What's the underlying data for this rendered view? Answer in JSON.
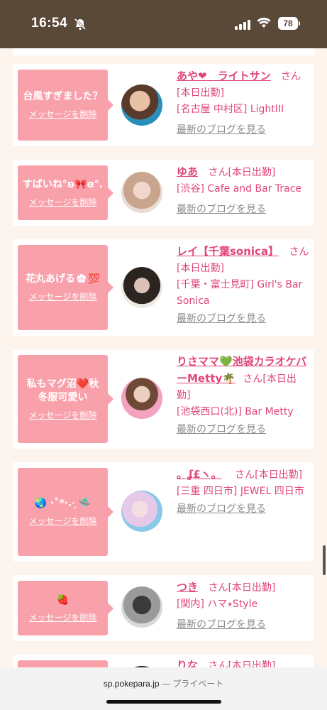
{
  "status": {
    "time": "16:54",
    "battery": "78"
  },
  "cards": [
    {
      "message": "台風すぎました？",
      "delete": "メッセージを削除",
      "name": "あや❤︎　ライトサン",
      "san": "さん",
      "line1": "[本日出勤]",
      "line2": "[名古屋 中村区] LightIII",
      "line3": "",
      "blog": "最新のブログを見る"
    },
    {
      "message": "すばいね°ʚ🎀ɞ°.",
      "delete": "メッセージを削除",
      "name": "ゆあ",
      "san": "さん[本日出勤]",
      "line1": "[渋谷] Cafe and Bar Trace",
      "line2": "",
      "line3": "",
      "blog": "最新のブログを見る"
    },
    {
      "message": "花丸あげる💮💯",
      "delete": "メッセージを削除",
      "name": "レイ【千葉sonica】",
      "san": "さん",
      "line1": "[本日出勤]",
      "line2": "[千葉・富士見町] Girl's Bar",
      "line3": "Sonica",
      "blog": "最新のブログを見る"
    },
    {
      "message": "私もマグ沼❤️秋冬服可愛い",
      "delete": "メッセージを削除",
      "name": "りさママ💚池袋カラオケバーMetty🌴",
      "san": "さん[本日出勤]",
      "line1": "[池袋西口(北)] Bar Metty",
      "line2": "",
      "line3": "",
      "blog": "最新のブログを見る"
    },
    {
      "message": "🌏 ·˚*·.·̩͙ 🛸",
      "delete": "メッセージを削除",
      "name": "。ʆ£ヽ。",
      "san": "さん[本日出勤]",
      "line1": "[三重 四日市] JEWEL 四日市",
      "line2": "",
      "line3": "",
      "blog": "最新のブログを見る"
    },
    {
      "message": "🍓",
      "delete": "メッセージを削除",
      "name": "つき",
      "san": "さん[本日出勤]",
      "line1": "[関内] ハマ⭑Style",
      "line2": "",
      "line3": "",
      "blog": "最新のブログを見る"
    },
    {
      "message": "",
      "delete": "",
      "name": "りな",
      "san": "さん[本日出勤]",
      "line1": "",
      "line2": "",
      "line3": "",
      "blog": ""
    }
  ],
  "urlbar": {
    "domain": "sp.pokepara.jp",
    "private": "— プライベート"
  },
  "colors": {
    "accent": "#e0457b",
    "bubble": "#f9a1ab",
    "statusbar": "#5a4839"
  }
}
